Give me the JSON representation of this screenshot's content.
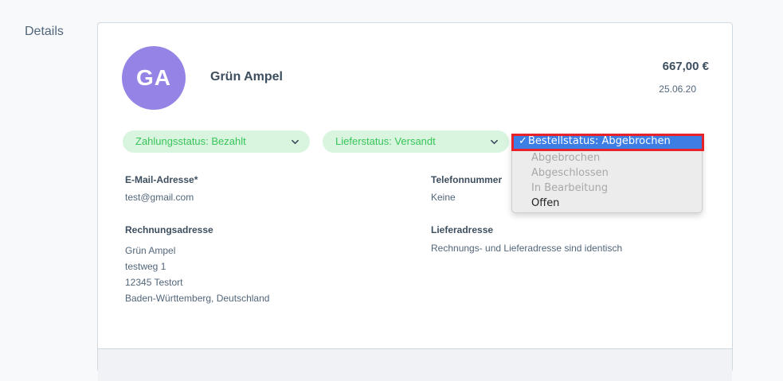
{
  "section": {
    "label": "Details"
  },
  "customer": {
    "initials": "GA",
    "name": "Grün Ampel",
    "avatar_color": "#9584e5"
  },
  "order": {
    "total": "667,00 €",
    "date": "25.06.20"
  },
  "statuses": {
    "payment": "Zahlungsstatus: Bezahlt",
    "delivery": "Lieferstatus: Versandt",
    "pill_bg": "#d9f5df",
    "pill_text": "#37c45a"
  },
  "order_status_dropdown": {
    "selected": "Bestellstatus: Abgebrochen",
    "check": "✓",
    "options": [
      {
        "label": "Abgebrochen",
        "disabled": true
      },
      {
        "label": "Abgeschlossen",
        "disabled": true
      },
      {
        "label": "In Bearbeitung",
        "disabled": true
      },
      {
        "label": "Offen",
        "disabled": false
      }
    ],
    "highlight_color": "#3d7ee5",
    "outline_color": "#e8222b"
  },
  "fields": {
    "email_label": "E-Mail-Adresse*",
    "email_value": "test@gmail.com",
    "phone_label": "Telefonnummer",
    "phone_value": "Keine",
    "billing_label": "Rechnungsadresse",
    "billing_lines": [
      "Grün Ampel",
      "testweg 1",
      "12345 Testort",
      "Baden-Württemberg, Deutschland"
    ],
    "shipping_label": "Lieferadresse",
    "shipping_value": "Rechnungs- und Lieferadresse sind identisch"
  }
}
